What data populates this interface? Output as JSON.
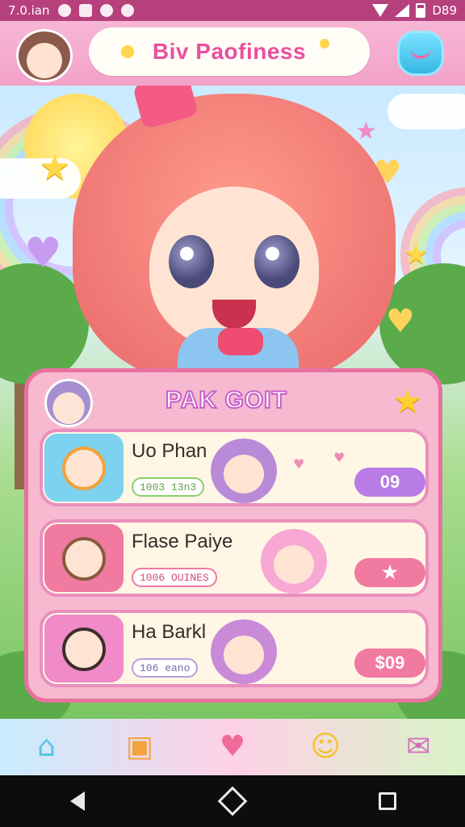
{
  "status_bar": {
    "time": "7.0.ian",
    "battery_text": "D89"
  },
  "header": {
    "title": "Biv Paofiness"
  },
  "panel": {
    "title": "PAK GOIT"
  },
  "cards": [
    {
      "name": "Uo Phan",
      "tag": "1003 13n3",
      "pill": "09",
      "thumb_color": "#7cd2ef",
      "tag_color": "#8bcf6b",
      "pill_color": "#b97be6"
    },
    {
      "name": "Flase Paiye",
      "tag": "1006 OUINES",
      "pill": "★",
      "thumb_color": "#f07aa0",
      "tag_color": "#f07aa0",
      "pill_color": "#f07aa0"
    },
    {
      "name": "Ha Barkl",
      "tag": "106 eano",
      "pill": "$09",
      "thumb_color": "#f08ac8",
      "tag_color": "#b7a0d8",
      "pill_color": "#f07aa0"
    }
  ],
  "bottom_nav": [
    {
      "icon": "home-icon"
    },
    {
      "icon": "gift-box-icon"
    },
    {
      "icon": "heart-icon"
    },
    {
      "icon": "smiley-icon"
    },
    {
      "icon": "mail-icon"
    }
  ],
  "colors": {
    "accent": "#ea4fa0",
    "panel_border": "#e8719f",
    "status_bar": "#b5407c"
  }
}
